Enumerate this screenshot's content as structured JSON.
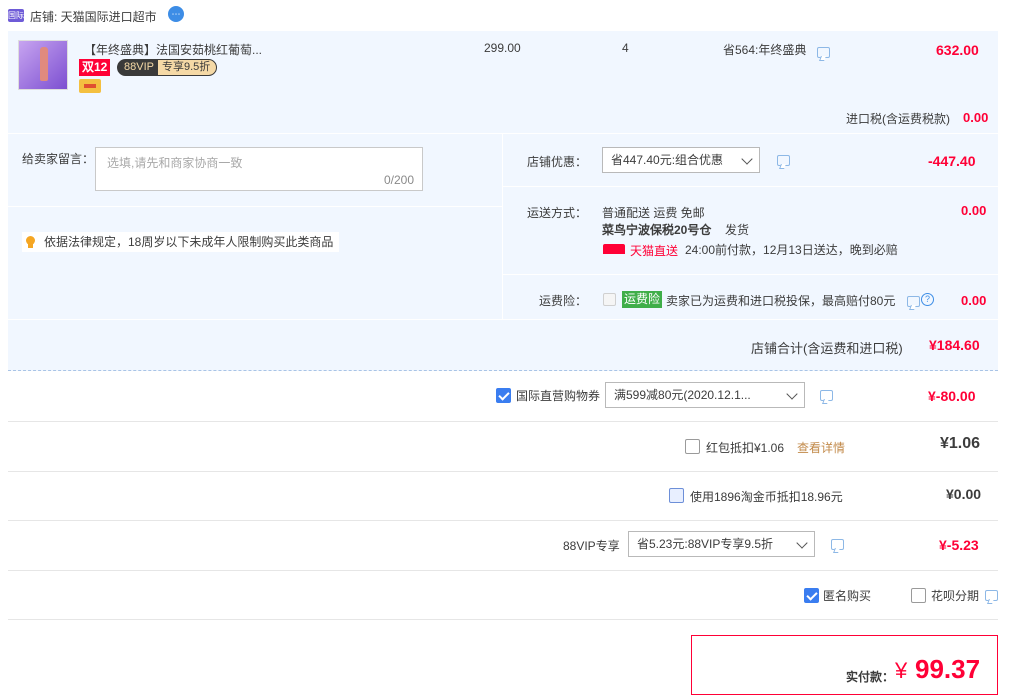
{
  "shop": {
    "badge": "国际",
    "label": "店铺: 天猫国际进口超市"
  },
  "item": {
    "title": "【年终盛典】法国安茹桃红葡萄...",
    "tag_double12": "双12",
    "tag_88vip": "88VIP",
    "tag_discount": "专享9.5折",
    "price": "299.00",
    "quantity": "4",
    "promo": "省564:年终盛典",
    "subtotal": "632.00"
  },
  "import_tax": {
    "label": "进口税(含运费税款)",
    "value": "0.00"
  },
  "message": {
    "label": "给卖家留言：",
    "placeholder": "选填,请先和商家协商一致",
    "counter": "0/200"
  },
  "notice": "依据法律规定，18周岁以下未成年人限制购买此类商品",
  "shop_discount": {
    "label": "店铺优惠：",
    "selected": "省447.40元:组合优惠",
    "value": "-447.40"
  },
  "shipping": {
    "label": "运送方式：",
    "line1": "普通配送 运费 免邮",
    "warehouse": "菜鸟宁波保税20号仓",
    "dispatch": "发货",
    "tmall_express": "天猫直送",
    "delivery": "24:00前付款，12月13日送达，晚到必赔",
    "value": "0.00"
  },
  "insurance": {
    "label": "运费险：",
    "tag": "运费险",
    "text": "卖家已为运费和进口税投保，最高赔付80元",
    "value": "0.00"
  },
  "shop_total": {
    "label": "店铺合计(含运费和进口税)",
    "value": "¥184.60"
  },
  "coupon": {
    "label": "国际直营购物券",
    "selected": "满599减80元(2020.12.1...",
    "value": "¥-80.00"
  },
  "red_packet": {
    "label": "红包抵扣¥1.06",
    "link": "查看详情",
    "value": "¥1.06"
  },
  "taobao_coin": {
    "label": "使用1896淘金币抵扣18.96元",
    "value": "¥0.00"
  },
  "vip": {
    "label": "88VIP专享",
    "selected": "省5.23元:88VIP专享9.5折",
    "value": "¥-5.23"
  },
  "options": {
    "anonymous": "匿名购买",
    "huabei": "花呗分期"
  },
  "payment": {
    "label": "实付款：",
    "currency": "¥",
    "value": "99.37"
  },
  "colors": {
    "accent": "#ff0036",
    "panel": "#f1f7ff",
    "checkbox": "#3a7df0"
  }
}
